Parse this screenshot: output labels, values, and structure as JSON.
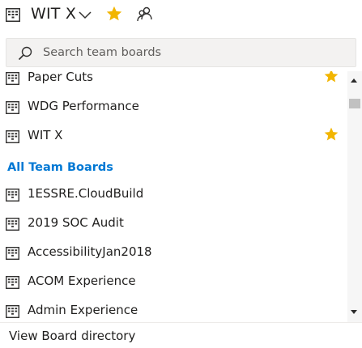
{
  "header": {
    "title": "WIT X",
    "board_icon": "board-icon",
    "chevron_icon": "chevron-down-icon",
    "favorite_icon": "star-icon",
    "team_icon": "people-icon",
    "favorite_color": "#f2b500"
  },
  "search": {
    "placeholder": "Search team boards",
    "value": "",
    "icon": "search-icon"
  },
  "favorites": [
    {
      "label": "Paper Cuts",
      "favorited": true
    },
    {
      "label": "WDG Performance",
      "favorited": false
    },
    {
      "label": "WIT X",
      "favorited": true
    }
  ],
  "all_team_boards": {
    "heading": "All Team Boards",
    "heading_color": "#0078d4",
    "items": [
      {
        "label": "1ESSRE.CloudBuild"
      },
      {
        "label": "2019 SOC Audit"
      },
      {
        "label": "AccessibilityJan2018"
      },
      {
        "label": "ACOM Experience"
      },
      {
        "label": "Admin Experience"
      }
    ]
  },
  "footer": {
    "link_label": "View Board directory"
  }
}
